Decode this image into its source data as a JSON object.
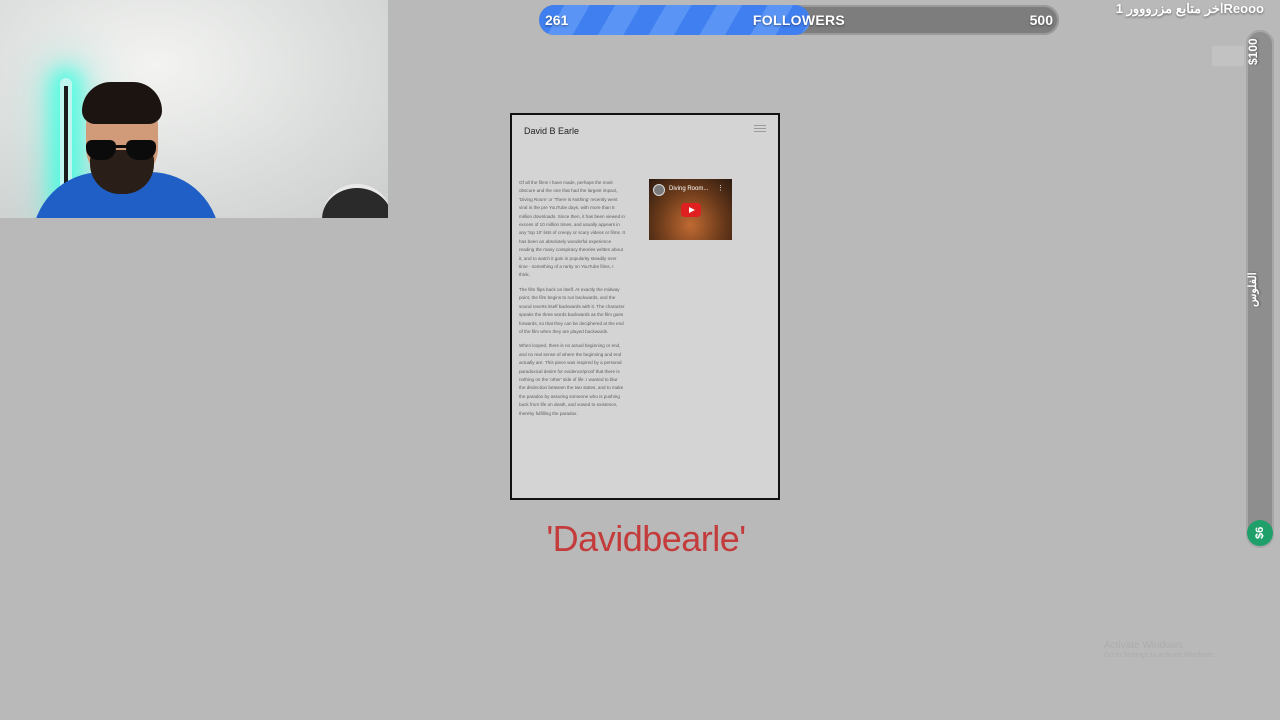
{
  "webcam": {
    "alt": "streamer webcam"
  },
  "followers_bar": {
    "current": "261",
    "label": "FOLLOWERS",
    "goal": "500",
    "progress": 0.522,
    "fill_colors": [
      "#3f7ff0",
      "#5a95f6"
    ]
  },
  "top_right": {
    "text": "اخر متابع مزرووور 1Reooo"
  },
  "donation_meter": {
    "top_label": "$100",
    "middle_label": "الفلوس",
    "bottom_label": "$6",
    "bottom_color": "#1f9f6a"
  },
  "document": {
    "title": "David B Earle",
    "paragraphs": [
      "Of all the films I have made, perhaps the most obscure and the one that had the largest impact, 'Diving Room' or 'There is Nothing' recently went viral in the pre YouTube days, with more than 5 million downloads. Since then, it has been viewed in excess of 10 million times, and usually appears in any 'top 10' lists of creepy or scary videos or films. It has been an absolutely wonderful experience reading the many conspiracy theories written about it, and to watch it gain in popularity steadily over time - something of a rarity on YouTube films, I think.",
      "The film flips back on itself. At exactly the midway point, the film begins to run backwards, and the sound reverts itself backwards with it. The character speaks the three words backwards as the film goes forwards, so that they can be deciphered at the end of the film when they are played backwards.",
      "When looped, there is no actual beginning or end, and no real sense of where the beginning and end actually are. This piece was inspired by a personal paradoxical desire for evidence/proof that there is nothing on the 'other' side of life. I wanted to blur the distinction between the two states, and to make the paradox by assuring someone who is pushing back from life on death, and vowed to existence, thereby fulfilling the paradox."
    ],
    "video": {
      "title": "Diving Room...",
      "menu_glyph": "⋮",
      "play_color": "#e02020"
    }
  },
  "caption": {
    "text": "'Davidbearle'",
    "color": "#c33b3b"
  },
  "watermark": {
    "line1": "Activate Windows",
    "line2": "Go to Settings to activate Windows."
  }
}
